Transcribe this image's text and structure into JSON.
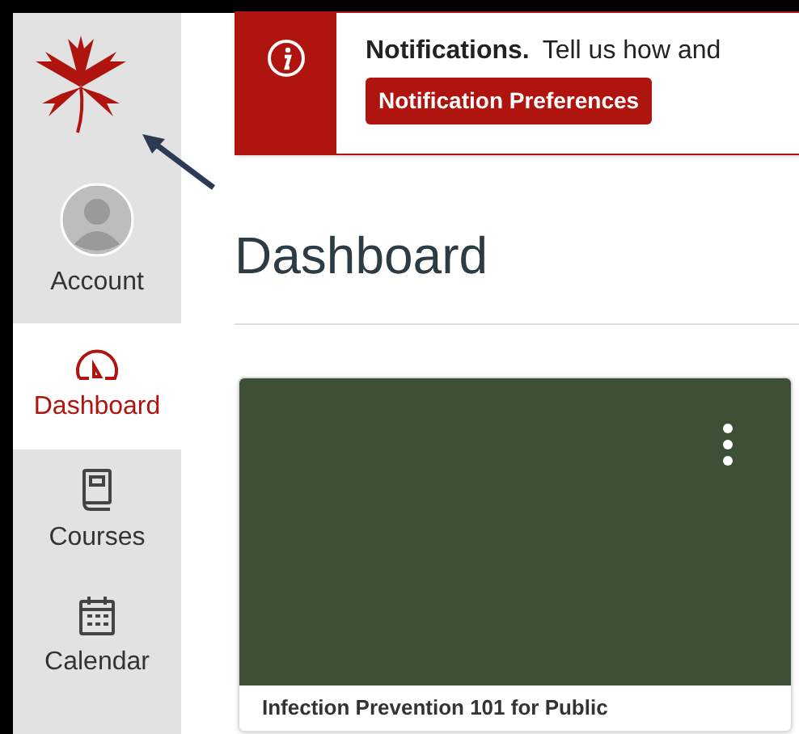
{
  "notification": {
    "title": "Notifications.",
    "text": "Tell us how and",
    "button": "Notification Preferences"
  },
  "nav": [
    {
      "kind": "account",
      "label": "Account",
      "selected": false
    },
    {
      "kind": "dashboard",
      "label": "Dashboard",
      "selected": true
    },
    {
      "kind": "courses",
      "label": "Courses",
      "selected": false
    },
    {
      "kind": "calendar",
      "label": "Calendar",
      "selected": false
    }
  ],
  "heading": "Dashboard",
  "card": {
    "color": "#3d4f35",
    "title": "Infection Prevention 101 for Public"
  }
}
